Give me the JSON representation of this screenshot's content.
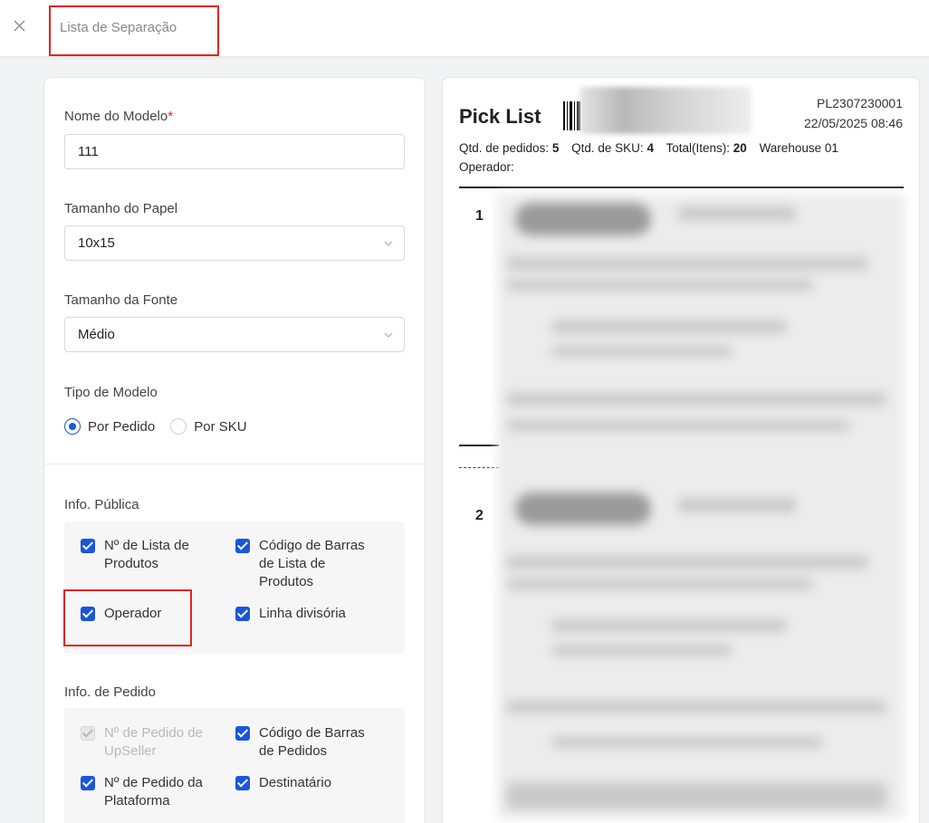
{
  "header": {
    "title": "Lista de Separação",
    "close_icon": "close-icon"
  },
  "form": {
    "model_name": {
      "label": "Nome do Modelo",
      "required_mark": "*",
      "value": "111"
    },
    "paper_size": {
      "label": "Tamanho do Papel",
      "value": "10x15"
    },
    "font_size": {
      "label": "Tamanho da Fonte",
      "value": "Médio"
    },
    "model_type": {
      "label": "Tipo de Modelo",
      "options": [
        "Por Pedido",
        "Por SKU"
      ],
      "selected": "Por Pedido"
    }
  },
  "public_info": {
    "label": "Info. Pública",
    "items": [
      {
        "label": "Nº de Lista de Produtos",
        "checked": true,
        "disabled": false
      },
      {
        "label": "Código de Barras de Lista de Produtos",
        "checked": true,
        "disabled": false
      },
      {
        "label": "Operador",
        "checked": true,
        "disabled": false
      },
      {
        "label": "Linha divisória",
        "checked": true,
        "disabled": false
      }
    ]
  },
  "order_info": {
    "label": "Info. de Pedido",
    "items": [
      {
        "label": "Nº de Pedido de UpSeller",
        "checked": true,
        "disabled": true
      },
      {
        "label": "Código de Barras de Pedidos",
        "checked": true,
        "disabled": false
      },
      {
        "label": "Nº de Pedido da Plataforma",
        "checked": true,
        "disabled": false
      },
      {
        "label": "Destinatário",
        "checked": true,
        "disabled": false
      }
    ]
  },
  "preview": {
    "title": "Pick List",
    "code": "PL2307230001",
    "datetime": "22/05/2025 08:46",
    "stats": {
      "orders_label": "Qtd. de pedidos:",
      "orders_value": "5",
      "sku_label": "Qtd. de SKU:",
      "sku_value": "4",
      "total_label": "Total(Itens):",
      "total_value": "20",
      "warehouse": "Warehouse 01"
    },
    "operator_label": "Operador:",
    "rows": [
      "1",
      "2"
    ]
  },
  "colors": {
    "accent": "#1a56db",
    "highlight": "#e32420"
  }
}
